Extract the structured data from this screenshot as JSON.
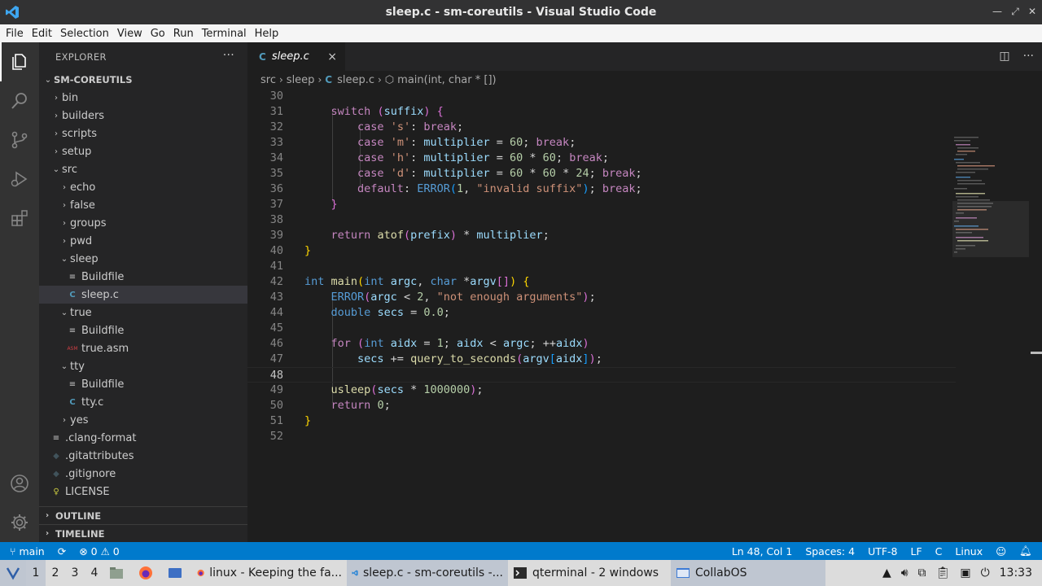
{
  "window": {
    "title": "sleep.c - sm-coreutils - Visual Studio Code"
  },
  "menu": [
    "File",
    "Edit",
    "Selection",
    "View",
    "Go",
    "Run",
    "Terminal",
    "Help"
  ],
  "sidebar": {
    "title": "EXPLORER",
    "more": "···",
    "root": "SM-COREUTILS",
    "tree": [
      {
        "label": "bin",
        "type": "folder",
        "depth": 1,
        "open": false
      },
      {
        "label": "builders",
        "type": "folder",
        "depth": 1,
        "open": false
      },
      {
        "label": "scripts",
        "type": "folder",
        "depth": 1,
        "open": false
      },
      {
        "label": "setup",
        "type": "folder",
        "depth": 1,
        "open": false
      },
      {
        "label": "src",
        "type": "folder",
        "depth": 1,
        "open": true
      },
      {
        "label": "echo",
        "type": "folder",
        "depth": 2,
        "open": false
      },
      {
        "label": "false",
        "type": "folder",
        "depth": 2,
        "open": false
      },
      {
        "label": "groups",
        "type": "folder",
        "depth": 2,
        "open": false
      },
      {
        "label": "pwd",
        "type": "folder",
        "depth": 2,
        "open": false
      },
      {
        "label": "sleep",
        "type": "folder",
        "depth": 2,
        "open": true
      },
      {
        "label": "Buildfile",
        "type": "file-lines",
        "depth": 3
      },
      {
        "label": "sleep.c",
        "type": "file-c",
        "depth": 3,
        "selected": true
      },
      {
        "label": "true",
        "type": "folder",
        "depth": 2,
        "open": true
      },
      {
        "label": "Buildfile",
        "type": "file-lines",
        "depth": 3
      },
      {
        "label": "true.asm",
        "type": "file-asm",
        "depth": 3
      },
      {
        "label": "tty",
        "type": "folder",
        "depth": 2,
        "open": true
      },
      {
        "label": "Buildfile",
        "type": "file-lines",
        "depth": 3
      },
      {
        "label": "tty.c",
        "type": "file-c",
        "depth": 3
      },
      {
        "label": "yes",
        "type": "folder",
        "depth": 2,
        "open": false
      },
      {
        "label": ".clang-format",
        "type": "file-lines",
        "depth": 1
      },
      {
        "label": ".gitattributes",
        "type": "file-git",
        "depth": 1
      },
      {
        "label": ".gitignore",
        "type": "file-git",
        "depth": 1
      },
      {
        "label": "LICENSE",
        "type": "file-license",
        "depth": 1
      }
    ],
    "outline": "OUTLINE",
    "timeline": "TIMELINE"
  },
  "editor": {
    "tab": {
      "label": "sleep.c",
      "icon": "C",
      "close": "×"
    },
    "breadcrumb": {
      "parts": [
        "src",
        "sleep",
        "sleep.c",
        "main(int, char * [])"
      ],
      "icon": "C"
    },
    "current_line": 48,
    "lines": [
      {
        "n": "30",
        "t": [
          [
            "plain",
            ""
          ]
        ]
      },
      {
        "n": "31",
        "t": [
          [
            "plain",
            "    "
          ],
          [
            "ctl",
            "switch"
          ],
          [
            "plain",
            " "
          ],
          [
            "brk2",
            "("
          ],
          [
            "var",
            "suffix"
          ],
          [
            "brk2",
            ")"
          ],
          [
            "plain",
            " "
          ],
          [
            "brk2",
            "{"
          ]
        ]
      },
      {
        "n": "32",
        "t": [
          [
            "plain",
            "        "
          ],
          [
            "ctl",
            "case"
          ],
          [
            "plain",
            " "
          ],
          [
            "str",
            "'s'"
          ],
          [
            "plain",
            ": "
          ],
          [
            "ctl",
            "break"
          ],
          [
            "plain",
            ";"
          ]
        ]
      },
      {
        "n": "33",
        "t": [
          [
            "plain",
            "        "
          ],
          [
            "ctl",
            "case"
          ],
          [
            "plain",
            " "
          ],
          [
            "str",
            "'m'"
          ],
          [
            "plain",
            ": "
          ],
          [
            "var",
            "multiplier"
          ],
          [
            "plain",
            " = "
          ],
          [
            "num",
            "60"
          ],
          [
            "plain",
            "; "
          ],
          [
            "ctl",
            "break"
          ],
          [
            "plain",
            ";"
          ]
        ]
      },
      {
        "n": "34",
        "t": [
          [
            "plain",
            "        "
          ],
          [
            "ctl",
            "case"
          ],
          [
            "plain",
            " "
          ],
          [
            "str",
            "'h'"
          ],
          [
            "plain",
            ": "
          ],
          [
            "var",
            "multiplier"
          ],
          [
            "plain",
            " = "
          ],
          [
            "num",
            "60"
          ],
          [
            "plain",
            " * "
          ],
          [
            "num",
            "60"
          ],
          [
            "plain",
            "; "
          ],
          [
            "ctl",
            "break"
          ],
          [
            "plain",
            ";"
          ]
        ]
      },
      {
        "n": "35",
        "t": [
          [
            "plain",
            "        "
          ],
          [
            "ctl",
            "case"
          ],
          [
            "plain",
            " "
          ],
          [
            "str",
            "'d'"
          ],
          [
            "plain",
            ": "
          ],
          [
            "var",
            "multiplier"
          ],
          [
            "plain",
            " = "
          ],
          [
            "num",
            "60"
          ],
          [
            "plain",
            " * "
          ],
          [
            "num",
            "60"
          ],
          [
            "plain",
            " * "
          ],
          [
            "num",
            "24"
          ],
          [
            "plain",
            "; "
          ],
          [
            "ctl",
            "break"
          ],
          [
            "plain",
            ";"
          ]
        ]
      },
      {
        "n": "36",
        "t": [
          [
            "plain",
            "        "
          ],
          [
            "ctl",
            "default"
          ],
          [
            "plain",
            ": "
          ],
          [
            "mac",
            "ERROR"
          ],
          [
            "brk3",
            "("
          ],
          [
            "num",
            "1"
          ],
          [
            "plain",
            ", "
          ],
          [
            "str",
            "\"invalid suffix\""
          ],
          [
            "brk3",
            ")"
          ],
          [
            "plain",
            "; "
          ],
          [
            "ctl",
            "break"
          ],
          [
            "plain",
            ";"
          ]
        ]
      },
      {
        "n": "37",
        "t": [
          [
            "plain",
            "    "
          ],
          [
            "brk2",
            "}"
          ]
        ]
      },
      {
        "n": "38",
        "t": [
          [
            "plain",
            ""
          ]
        ]
      },
      {
        "n": "39",
        "t": [
          [
            "plain",
            "    "
          ],
          [
            "ctl",
            "return"
          ],
          [
            "plain",
            " "
          ],
          [
            "fn",
            "atof"
          ],
          [
            "brk2",
            "("
          ],
          [
            "var",
            "prefix"
          ],
          [
            "brk2",
            ")"
          ],
          [
            "plain",
            " * "
          ],
          [
            "var",
            "multiplier"
          ],
          [
            "plain",
            ";"
          ]
        ]
      },
      {
        "n": "40",
        "t": [
          [
            "brk",
            "}"
          ]
        ]
      },
      {
        "n": "41",
        "t": [
          [
            "plain",
            ""
          ]
        ]
      },
      {
        "n": "42",
        "t": [
          [
            "kw",
            "int"
          ],
          [
            "plain",
            " "
          ],
          [
            "fn",
            "main"
          ],
          [
            "brk",
            "("
          ],
          [
            "kw",
            "int"
          ],
          [
            "plain",
            " "
          ],
          [
            "var",
            "argc"
          ],
          [
            "plain",
            ", "
          ],
          [
            "kw",
            "char"
          ],
          [
            "plain",
            " *"
          ],
          [
            "var",
            "argv"
          ],
          [
            "brk2",
            "[]"
          ],
          [
            "brk",
            ")"
          ],
          [
            "plain",
            " "
          ],
          [
            "brk",
            "{"
          ]
        ]
      },
      {
        "n": "43",
        "t": [
          [
            "plain",
            "    "
          ],
          [
            "mac",
            "ERROR"
          ],
          [
            "brk2",
            "("
          ],
          [
            "var",
            "argc"
          ],
          [
            "plain",
            " < "
          ],
          [
            "num",
            "2"
          ],
          [
            "plain",
            ", "
          ],
          [
            "str",
            "\"not enough arguments\""
          ],
          [
            "brk2",
            ")"
          ],
          [
            "plain",
            ";"
          ]
        ]
      },
      {
        "n": "44",
        "t": [
          [
            "plain",
            "    "
          ],
          [
            "kw",
            "double"
          ],
          [
            "plain",
            " "
          ],
          [
            "var",
            "secs"
          ],
          [
            "plain",
            " = "
          ],
          [
            "num",
            "0.0"
          ],
          [
            "plain",
            ";"
          ]
        ]
      },
      {
        "n": "45",
        "t": [
          [
            "plain",
            ""
          ]
        ]
      },
      {
        "n": "46",
        "t": [
          [
            "plain",
            "    "
          ],
          [
            "ctl",
            "for"
          ],
          [
            "plain",
            " "
          ],
          [
            "brk2",
            "("
          ],
          [
            "kw",
            "int"
          ],
          [
            "plain",
            " "
          ],
          [
            "var",
            "aidx"
          ],
          [
            "plain",
            " = "
          ],
          [
            "num",
            "1"
          ],
          [
            "plain",
            "; "
          ],
          [
            "var",
            "aidx"
          ],
          [
            "plain",
            " < "
          ],
          [
            "var",
            "argc"
          ],
          [
            "plain",
            "; ++"
          ],
          [
            "var",
            "aidx"
          ],
          [
            "brk2",
            ")"
          ]
        ]
      },
      {
        "n": "47",
        "t": [
          [
            "plain",
            "        "
          ],
          [
            "var",
            "secs"
          ],
          [
            "plain",
            " += "
          ],
          [
            "fn",
            "query_to_seconds"
          ],
          [
            "brk2",
            "("
          ],
          [
            "var",
            "argv"
          ],
          [
            "brk3",
            "["
          ],
          [
            "var",
            "aidx"
          ],
          [
            "brk3",
            "]"
          ],
          [
            "brk2",
            ")"
          ],
          [
            "plain",
            ";"
          ]
        ]
      },
      {
        "n": "48",
        "t": [
          [
            "plain",
            ""
          ]
        ]
      },
      {
        "n": "49",
        "t": [
          [
            "plain",
            "    "
          ],
          [
            "fn",
            "usleep"
          ],
          [
            "brk2",
            "("
          ],
          [
            "var",
            "secs"
          ],
          [
            "plain",
            " * "
          ],
          [
            "num",
            "1000000"
          ],
          [
            "brk2",
            ")"
          ],
          [
            "plain",
            ";"
          ]
        ]
      },
      {
        "n": "50",
        "t": [
          [
            "plain",
            "    "
          ],
          [
            "ctl",
            "return"
          ],
          [
            "plain",
            " "
          ],
          [
            "num",
            "0"
          ],
          [
            "plain",
            ";"
          ]
        ]
      },
      {
        "n": "51",
        "t": [
          [
            "brk",
            "}"
          ]
        ]
      },
      {
        "n": "52",
        "t": [
          [
            "plain",
            ""
          ]
        ]
      }
    ]
  },
  "statusbar": {
    "branch": "main",
    "errors": "0",
    "warnings": "0",
    "position": "Ln 48, Col 1",
    "spaces": "Spaces: 4",
    "encoding": "UTF-8",
    "eol": "LF",
    "language": "C",
    "platform": "Linux"
  },
  "taskbar": {
    "workspaces": [
      "1",
      "2",
      "3",
      "4"
    ],
    "windows": [
      {
        "label": "linux - Keeping the fa...",
        "icon": "firefox-icon"
      },
      {
        "label": "sleep.c - sm-coreutils -...",
        "icon": "vscode-icon",
        "active": true
      },
      {
        "label": "qterminal - 2 windows",
        "icon": "terminal-icon"
      },
      {
        "label": "CollabOS",
        "icon": "window-icon",
        "active": true
      }
    ],
    "clock": "13:33"
  },
  "colors": {
    "accent": "#007acc",
    "activity_bar": "#333333",
    "sidebar": "#252526",
    "editor": "#1e1e1e"
  }
}
